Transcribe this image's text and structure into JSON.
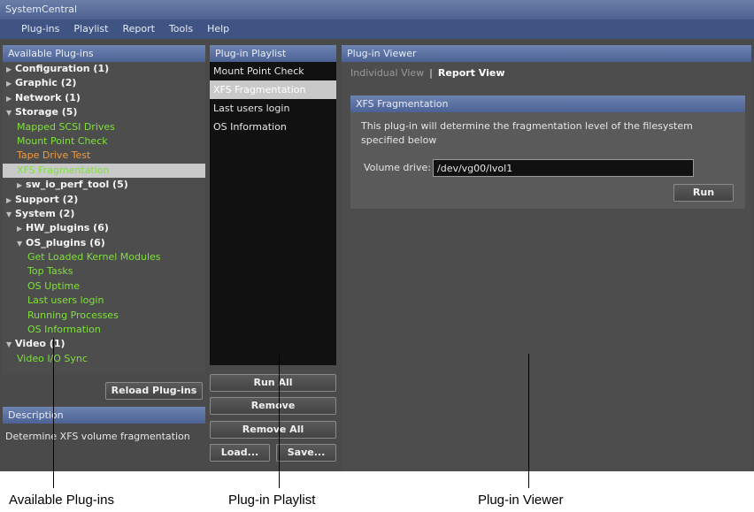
{
  "window": {
    "title": "SystemCentral"
  },
  "menu": [
    "Plug-ins",
    "Playlist",
    "Report",
    "Tools",
    "Help"
  ],
  "left_panel": {
    "header": "Available Plug-ins",
    "tree": [
      {
        "label": "Configuration (1)",
        "kind": "cat",
        "arrow": "right",
        "indent": 0
      },
      {
        "label": "Graphic (2)",
        "kind": "cat",
        "arrow": "right",
        "indent": 0
      },
      {
        "label": "Network (1)",
        "kind": "cat",
        "arrow": "right",
        "indent": 0
      },
      {
        "label": "Storage (5)",
        "kind": "cat",
        "arrow": "down",
        "indent": 0
      },
      {
        "label": "Mapped SCSI Drives",
        "kind": "plug",
        "indent": 1
      },
      {
        "label": "Mount Point Check",
        "kind": "plug",
        "indent": 1
      },
      {
        "label": "Tape Drive Test",
        "kind": "orange",
        "indent": 1
      },
      {
        "label": "XFS Fragmentation",
        "kind": "selected",
        "indent": 1
      },
      {
        "label": "sw_io_perf_tool (5)",
        "kind": "cat",
        "arrow": "right",
        "indent": 1
      },
      {
        "label": "Support (2)",
        "kind": "cat",
        "arrow": "right",
        "indent": 0
      },
      {
        "label": "System (2)",
        "kind": "cat",
        "arrow": "down",
        "indent": 0
      },
      {
        "label": "HW_plugins (6)",
        "kind": "cat",
        "arrow": "right",
        "indent": 1
      },
      {
        "label": "OS_plugins (6)",
        "kind": "cat",
        "arrow": "down",
        "indent": 1
      },
      {
        "label": "Get Loaded Kernel Modules",
        "kind": "plug",
        "indent": 2
      },
      {
        "label": "Top Tasks",
        "kind": "plug",
        "indent": 2
      },
      {
        "label": "OS Uptime",
        "kind": "plug",
        "indent": 2
      },
      {
        "label": "Last users login",
        "kind": "plug",
        "indent": 2
      },
      {
        "label": "Running Processes",
        "kind": "plug",
        "indent": 2
      },
      {
        "label": "OS Information",
        "kind": "plug",
        "indent": 2
      },
      {
        "label": "Video (1)",
        "kind": "cat",
        "arrow": "down",
        "indent": 0
      },
      {
        "label": "Video I/O Sync",
        "kind": "plug",
        "indent": 1
      }
    ],
    "reload_button": "Reload Plug-ins",
    "description_header": "Description",
    "description_text": "Determine XFS volume fragmentation"
  },
  "playlist_panel": {
    "header": "Plug-in Playlist",
    "items": [
      "Mount Point Check",
      "XFS Fragmentation",
      "Last users login",
      "OS Information"
    ],
    "selected_index": 1,
    "buttons": {
      "run_all": "Run All",
      "remove": "Remove",
      "remove_all": "Remove All",
      "load": "Load...",
      "save": "Save..."
    }
  },
  "viewer_panel": {
    "header": "Plug-in Viewer",
    "tab_individual": "Individual View",
    "tab_separator": "|",
    "tab_report": "Report View",
    "plugin_title": "XFS Fragmentation",
    "plugin_description": "This plug-in will determine the fragmentation level of the filesystem specified below",
    "volume_label": "Volume drive:",
    "volume_value": "/dev/vg00/lvol1",
    "run_button": "Run"
  },
  "callouts": [
    "Available Plug-ins",
    "Plug-in Playlist",
    "Plug-in Viewer"
  ]
}
